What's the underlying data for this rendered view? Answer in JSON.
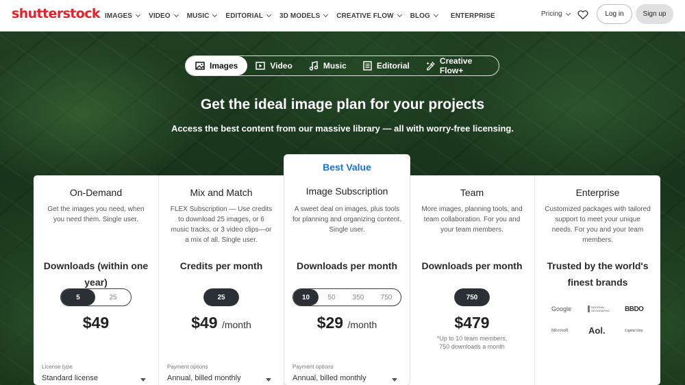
{
  "header": {
    "logo": "shutterstock",
    "nav": [
      "IMAGES",
      "VIDEO",
      "MUSIC",
      "EDITORIAL",
      "3D MODELS",
      "CREATIVE FLOW",
      "BLOG"
    ],
    "enterprise": "ENTERPRISE",
    "pricing": "Pricing",
    "login": "Log in",
    "signup": "Sign up"
  },
  "tabs": [
    {
      "label": "Images",
      "icon": "image-icon",
      "active": true
    },
    {
      "label": "Video",
      "icon": "video-icon"
    },
    {
      "label": "Music",
      "icon": "music-icon"
    },
    {
      "label": "Editorial",
      "icon": "editorial-icon"
    },
    {
      "label": "Creative Flow+",
      "icon": "creative-flow-icon"
    }
  ],
  "hero": {
    "title": "Get the ideal image plan for your projects",
    "subtitle": "Access the best content from our massive library — all with worry-free licensing."
  },
  "plans": [
    {
      "title": "On-Demand",
      "desc": "Get the images you need, when you need them. Single user.",
      "metric": "Downloads (within one year)",
      "options": [
        "5",
        "25"
      ],
      "selected": "5",
      "price": "$49",
      "unit": "",
      "option_label": "License type",
      "option_value": "Standard license"
    },
    {
      "title": "Mix and Match",
      "desc": "FLEX Subscription — Use credits to download 25 images, or 6 music tracks, or 3 video clips—or a mix of all. Single user.",
      "metric": "Credits per month",
      "options": [
        "25"
      ],
      "selected": "25",
      "price": "$49",
      "unit": "/month",
      "option_label": "Payment options",
      "option_value": "Annual, billed monthly"
    },
    {
      "badge": "Best Value",
      "title": "Image Subscription",
      "desc": "A sweet deal on images, plus tools for planning and organizing content. Single user.",
      "metric": "Downloads per month",
      "options": [
        "10",
        "50",
        "350",
        "750"
      ],
      "selected": "10",
      "price": "$29",
      "unit": "/month",
      "option_label": "Payment options",
      "option_value": "Annual, billed monthly"
    },
    {
      "title": "Team",
      "desc": "More images, planning tools, and team collaboration. For you and your team members.",
      "metric": "Downloads per month",
      "options": [
        "750"
      ],
      "selected": "750",
      "price": "$479",
      "unit": "",
      "note_line1": "*Up to 10 team members,",
      "note_line2": "750 downloads a month"
    },
    {
      "title": "Enterprise",
      "desc": "Customized packages with tailored support to meet your unique needs. For you and your team members.",
      "trusted_line1": "Trusted by the world's",
      "trusted_line2": "finest brands",
      "brands": [
        "Google",
        "NATIONAL GEOGRAPHIC",
        "BBDO",
        "Microsoft",
        "Aol.",
        "Capital One"
      ]
    }
  ],
  "colors": {
    "brand": "#e8202a",
    "accent": "#1a73d9",
    "selected": "#2b3037"
  }
}
